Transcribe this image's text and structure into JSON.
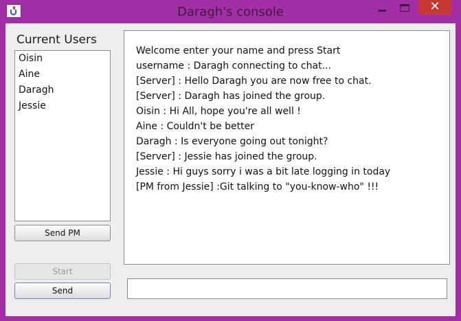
{
  "window": {
    "title": "Daragh's console",
    "controls": {
      "minimize_icon": "minimize-icon",
      "maximize_icon": "maximize-icon",
      "close_glyph": "✕"
    },
    "accent_color": "#a32fa6",
    "close_color": "#c7392f"
  },
  "users": {
    "title": "Current Users",
    "items": [
      "Oisin",
      "Aine",
      "Daragh",
      "Jessie"
    ]
  },
  "buttons": {
    "send_pm": "Send PM",
    "start": "Start",
    "send": "Send"
  },
  "chat": {
    "lines": [
      "Welcome enter your name and press Start",
      "username : Daragh connecting to chat...",
      "[Server] : Hello Daragh you are now free to chat.",
      "[Server] : Daragh has joined the group.",
      "Oisin : Hi All, hope you're all well !",
      "Aine : Couldn't be better",
      "Daragh : Is everyone going out tonight?",
      "[Server] : Jessie has joined the group.",
      "Jessie : Hi guys sorry i was a bit late logging in today",
      "[PM from Jessie] :Git talking to \"you-know-who\" !!!"
    ]
  },
  "input": {
    "value": ""
  }
}
